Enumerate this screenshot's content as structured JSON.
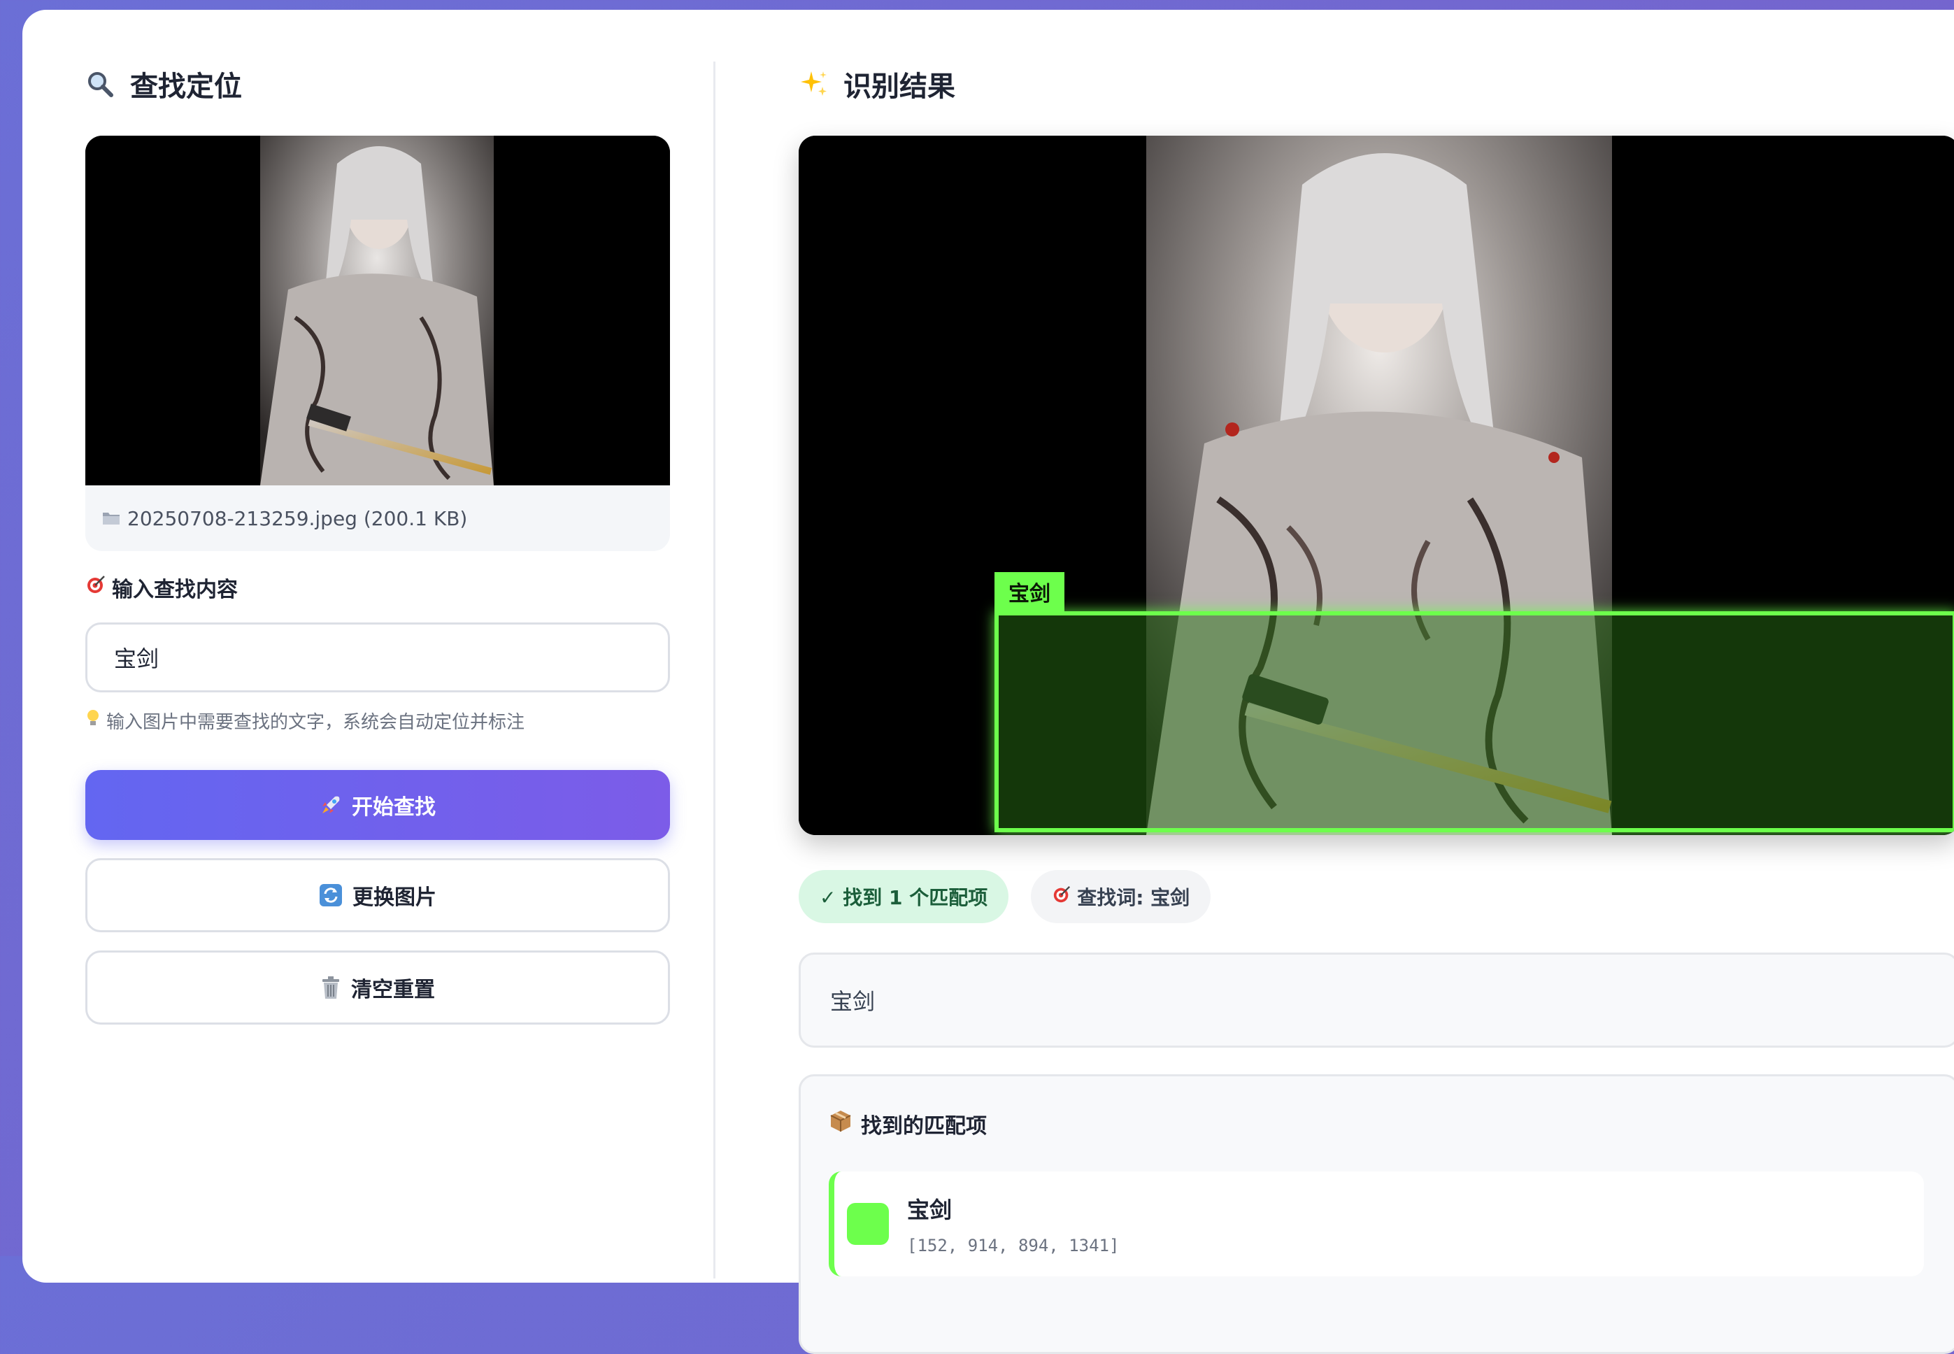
{
  "colors": {
    "accent": "#6366f1",
    "accent_end": "#7c5ce8",
    "match_green": "#6dff4c",
    "success_bg": "#d9f7e4",
    "success_text": "#1b5e3a"
  },
  "left_panel": {
    "title_icon": "magnifier-icon",
    "title": "查找定位",
    "uploaded_image": {
      "file_icon": "folder-icon",
      "file_info": "20250708-213259.jpeg (200.1 KB)"
    },
    "search_label_icon": "target-icon",
    "search_label": "输入查找内容",
    "search_value": "宝剑",
    "hint_icon": "lightbulb-icon",
    "hint": "输入图片中需要查找的文字，系统会自动定位并标注",
    "buttons": {
      "start": {
        "icon": "rocket-icon",
        "label": "开始查找"
      },
      "change": {
        "icon": "refresh-icon",
        "label": "更换图片"
      },
      "clear": {
        "icon": "trash-icon",
        "label": "清空重置"
      }
    }
  },
  "right_panel": {
    "title_icon": "sparkles-icon",
    "title": "识别结果",
    "detection_label": "宝剑",
    "found_badge": "✓ 找到 1 个匹配项",
    "query_badge_icon": "target-icon",
    "query_badge": "查找词: 宝剑",
    "recognized_text": "宝剑",
    "matches_icon": "package-icon",
    "matches_title": "找到的匹配项",
    "matches": [
      {
        "name": "宝剑",
        "coords": "[152, 914, 894, 1341]"
      }
    ]
  }
}
